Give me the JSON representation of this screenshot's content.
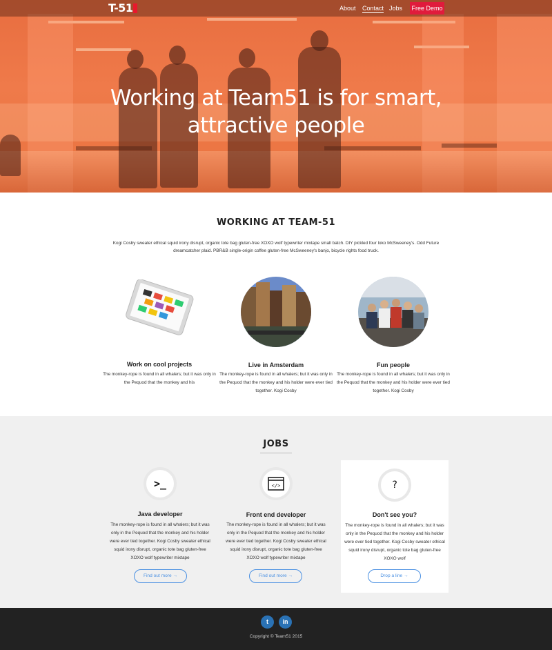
{
  "nav": {
    "logo": "T-51",
    "links": [
      "About",
      "Contact",
      "Jobs"
    ],
    "cta": "Free Demo"
  },
  "hero": {
    "title_line1": "Working at Team51 is for smart,",
    "title_line2": "attractive people"
  },
  "working": {
    "title": "WORKING AT TEAM-51",
    "intro": "Kogi Cosby sweater ethical squid irony disrupt, organic tote bag gluten-free XOXO wolf typewriter mixtape small batch. DIY pickled four loko McSweeney's. Odd Future dreamcatcher plaid. PBR&B single-origin coffee gluten-free McSweeney's banjo, bicycle rights food truck.",
    "features": [
      {
        "title": "Work on cool projects",
        "text": "The monkey-rope is found in all whalers; but it was only in the Pequod that the monkey and his"
      },
      {
        "title": "Live in Amsterdam",
        "text": "The monkey-rope is found in all whalers; but it was only in the Pequod that the monkey and his holder were ever tied together. Kogi Cosby"
      },
      {
        "title": "Fun people",
        "text": "The monkey-rope is found in all whalers; but it was only in the Pequod that the monkey and his holder were ever tied together. Kogi Cosby"
      }
    ]
  },
  "jobs": {
    "title": "JOBS",
    "items": [
      {
        "icon": "terminal-icon",
        "icon_text": ">_",
        "title": "Java developer",
        "text": "The monkey-rope is found in all whalers; but it was only in the Pequod that the monkey and his holder were ever tied together. Kogi Cosby sweater ethical squid irony disrupt, organic tote bag gluten-free XOXO wolf typewriter mixtape",
        "button": "Find out more →"
      },
      {
        "icon": "code-window-icon",
        "icon_text": "</>",
        "title": "Front end developer",
        "text": "The monkey-rope is found in all whalers; but it was only in the Pequod that the monkey and his holder were ever tied together. Kogi Cosby sweater ethical squid irony disrupt, organic tote bag gluten-free XOXO wolf typewriter mixtape",
        "button": "Find out more →"
      },
      {
        "icon": "question-icon",
        "icon_text": "?",
        "title": "Don't see you?",
        "text": "The monkey-rope is found in all whalers; but it was only in the Pequod that the monkey and his holder were ever tied together. Kogi Cosby sweater ethical squid irony disrupt, organic tote bag gluten-free XOXO wolf",
        "button": "Drop a line  →"
      }
    ]
  },
  "footer": {
    "social": [
      {
        "icon": "twitter-icon",
        "glyph": "t"
      },
      {
        "icon": "linkedin-icon",
        "glyph": "in"
      }
    ],
    "copyright": "Copyright © Team51 2015"
  },
  "colors": {
    "accent": "#e01b3c",
    "hero_overlay": "#ef7a4a",
    "button_blue": "#4a90e2",
    "footer": "#222222"
  }
}
